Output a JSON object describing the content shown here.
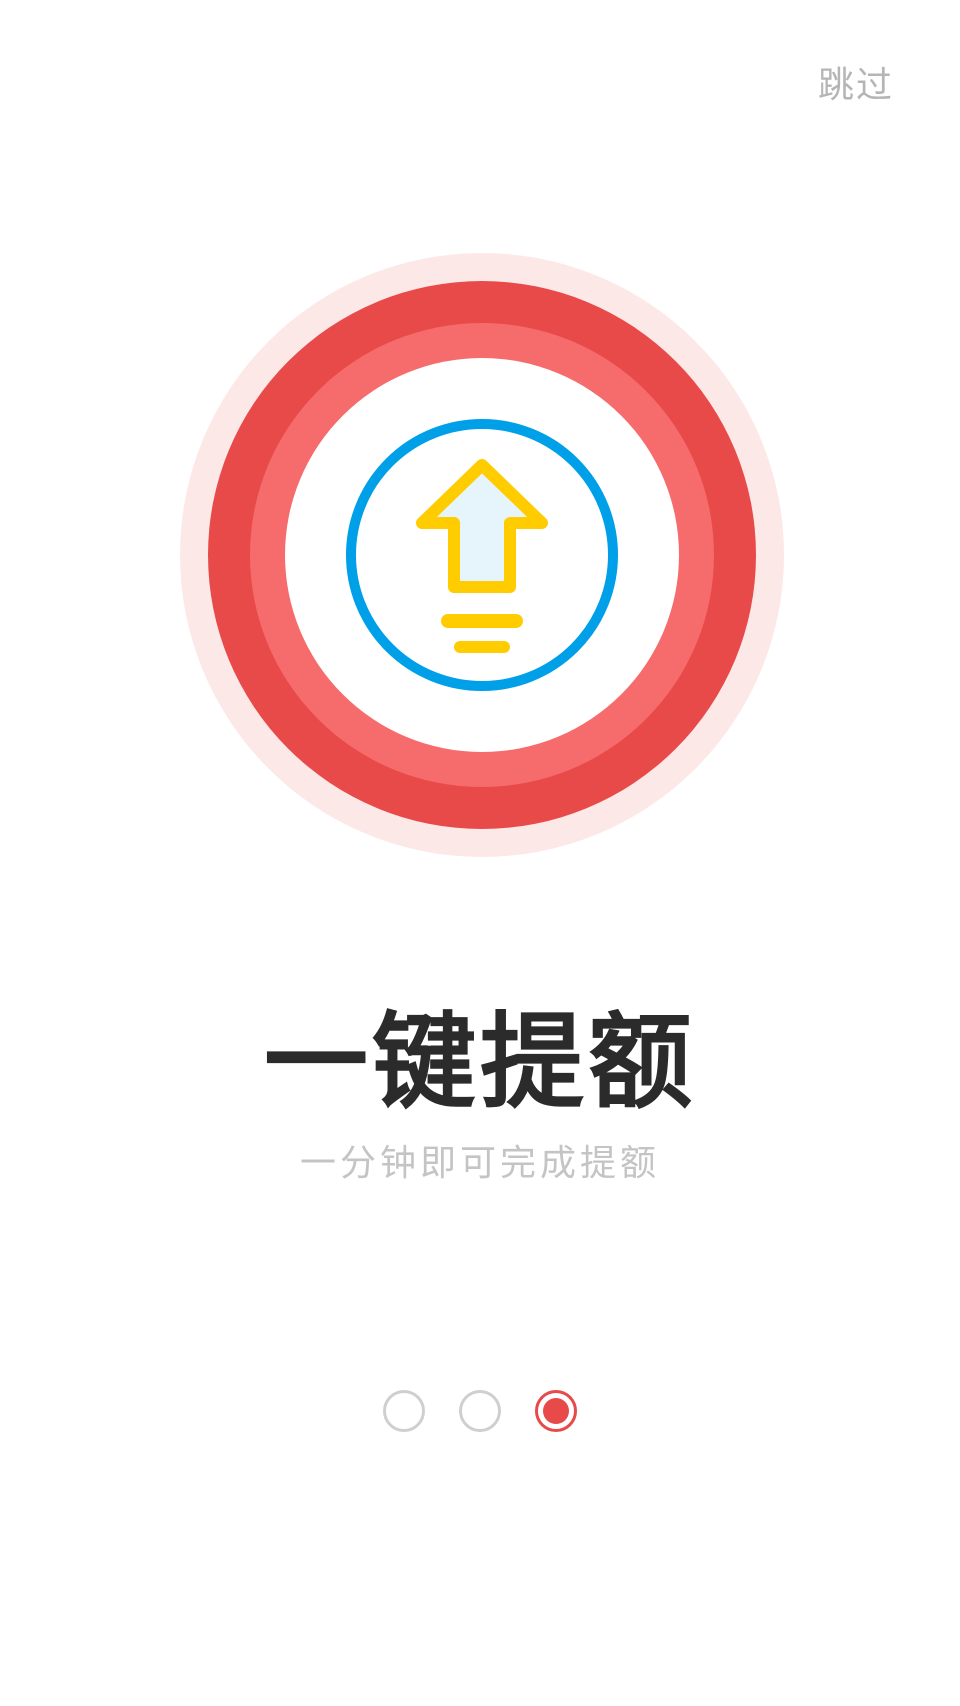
{
  "skip_label": "跳过",
  "hero": {
    "icon": "arrow-up-in-circle-icon",
    "colors": {
      "outer_halo": "#fde8e8",
      "ring_dark": "#e84a4a",
      "ring_light": "#f66b6b",
      "circle_stroke": "#00a0e9",
      "arrow": "#ffcc00",
      "arrow_fill": "#e6f4fb"
    }
  },
  "title": "一键提额",
  "subtitle": "一分钟即可完成提额",
  "pager": {
    "total": 3,
    "active_index": 3,
    "active_color": "#e84a4a",
    "inactive_color": "#cfcfcf"
  }
}
